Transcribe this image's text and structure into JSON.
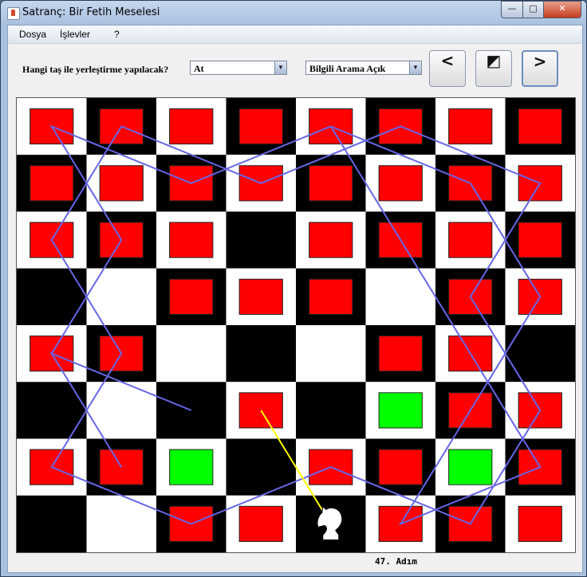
{
  "window": {
    "title": "Satranç: Bir Fetih Meselesi"
  },
  "menu": [
    "Dosya",
    "İşlevler",
    "?"
  ],
  "toolbar": {
    "piece_label": "Hangi taş ile yerleştirme yapılacak?",
    "piece_value": "At",
    "search_value": "Bilgili Arama Açık",
    "prev_label": "<",
    "reset_label": "◩",
    "next_label": ">"
  },
  "board": {
    "size": 8,
    "visited": [
      [
        0,
        0
      ],
      [
        0,
        1
      ],
      [
        0,
        2
      ],
      [
        0,
        3
      ],
      [
        0,
        4
      ],
      [
        0,
        5
      ],
      [
        0,
        6
      ],
      [
        0,
        7
      ],
      [
        1,
        0
      ],
      [
        1,
        1
      ],
      [
        1,
        2
      ],
      [
        1,
        3
      ],
      [
        1,
        4
      ],
      [
        1,
        5
      ],
      [
        1,
        6
      ],
      [
        1,
        7
      ],
      [
        2,
        0
      ],
      [
        2,
        1
      ],
      [
        2,
        2
      ],
      [
        2,
        4
      ],
      [
        2,
        5
      ],
      [
        2,
        6
      ],
      [
        2,
        7
      ],
      [
        3,
        2
      ],
      [
        3,
        3
      ],
      [
        3,
        4
      ],
      [
        3,
        6
      ],
      [
        3,
        7
      ],
      [
        4,
        0
      ],
      [
        4,
        1
      ],
      [
        4,
        5
      ],
      [
        4,
        6
      ],
      [
        5,
        3
      ],
      [
        5,
        6
      ],
      [
        5,
        7
      ],
      [
        6,
        0
      ],
      [
        6,
        1
      ],
      [
        6,
        4
      ],
      [
        6,
        5
      ],
      [
        6,
        7
      ],
      [
        7,
        2
      ],
      [
        7,
        3
      ],
      [
        7,
        5
      ],
      [
        7,
        6
      ],
      [
        7,
        7
      ]
    ],
    "candidates": [
      [
        5,
        5
      ],
      [
        6,
        2
      ],
      [
        6,
        6
      ]
    ],
    "knight": [
      7,
      4
    ],
    "path": [
      [
        7,
        2
      ],
      [
        6,
        0
      ],
      [
        4,
        1
      ],
      [
        2,
        0
      ],
      [
        0,
        1
      ],
      [
        1,
        3
      ],
      [
        0,
        5
      ],
      [
        1,
        7
      ],
      [
        3,
        6
      ],
      [
        5,
        7
      ],
      [
        7,
        6
      ],
      [
        6,
        4
      ],
      [
        7,
        2
      ]
    ],
    "path2": [
      [
        4,
        0
      ],
      [
        2,
        1
      ],
      [
        0,
        0
      ],
      [
        1,
        2
      ],
      [
        0,
        4
      ],
      [
        2,
        5
      ],
      [
        4,
        6
      ],
      [
        6,
        7
      ],
      [
        7,
        5
      ],
      [
        5,
        6
      ],
      [
        3,
        7
      ],
      [
        1,
        6
      ],
      [
        0,
        4
      ]
    ],
    "path3": [
      [
        6,
        1
      ],
      [
        4,
        0
      ],
      [
        5,
        2
      ]
    ],
    "last_move": [
      [
        5,
        3
      ],
      [
        7,
        4
      ]
    ],
    "colors": {
      "visited": "#ff0000",
      "candidate": "#00ff00",
      "path": "#6666e6",
      "last": "#ffff00"
    }
  },
  "status": {
    "step": "47. Adım"
  }
}
